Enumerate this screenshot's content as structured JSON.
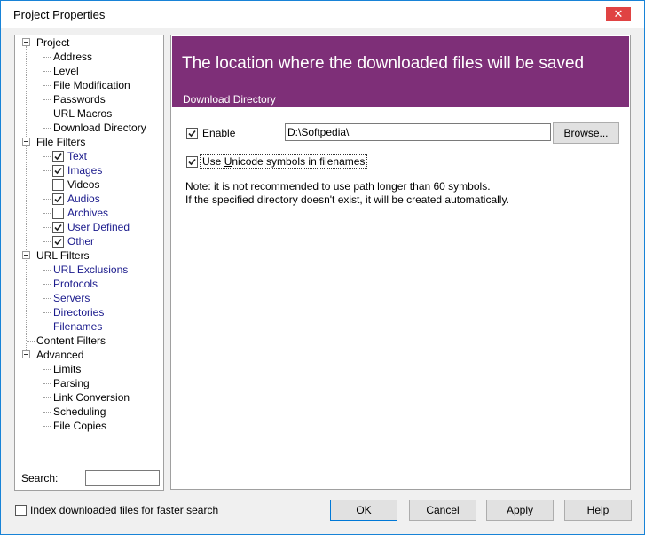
{
  "window": {
    "title": "Project Properties",
    "close_glyph": "✕"
  },
  "tree": {
    "project": "Project",
    "project_children": [
      "Address",
      "Level",
      "File Modification",
      "Passwords",
      "URL Macros",
      "Download Directory"
    ],
    "file_filters": "File Filters",
    "file_filter_items": [
      {
        "label": "Text",
        "checked": true
      },
      {
        "label": "Images",
        "checked": true
      },
      {
        "label": "Videos",
        "checked": false
      },
      {
        "label": "Audios",
        "checked": true
      },
      {
        "label": "Archives",
        "checked": false
      },
      {
        "label": "User Defined",
        "checked": true
      },
      {
        "label": "Other",
        "checked": true
      }
    ],
    "url_filters": "URL Filters",
    "url_filter_children": [
      "URL Exclusions",
      "Protocols",
      "Servers",
      "Directories",
      "Filenames"
    ],
    "content_filters": "Content Filters",
    "advanced": "Advanced",
    "advanced_children": [
      "Limits",
      "Parsing",
      "Link Conversion",
      "Scheduling",
      "File Copies"
    ],
    "search_label": "Search:",
    "search_value": ""
  },
  "panel": {
    "banner_title": "The location where the downloaded files will be saved",
    "banner_subtitle": "Download Directory",
    "banner_color": "#7e2f78",
    "enable_label": "Enable",
    "enable_checked": true,
    "directory_value": "D:\\Softpedia\\",
    "browse_label": "Browse...",
    "unicode_label": "Use Unicode symbols in filenames",
    "unicode_checked": true,
    "note_line1": "Note: it is not recommended to use path longer than 60 symbols.",
    "note_line2": "If the specified directory doesn't exist, it will be created automatically."
  },
  "footer": {
    "index_label": "Index downloaded files for faster search",
    "index_checked": false,
    "ok_label": "OK",
    "cancel_label": "Cancel",
    "apply_label": "Apply",
    "help_label": "Help"
  }
}
